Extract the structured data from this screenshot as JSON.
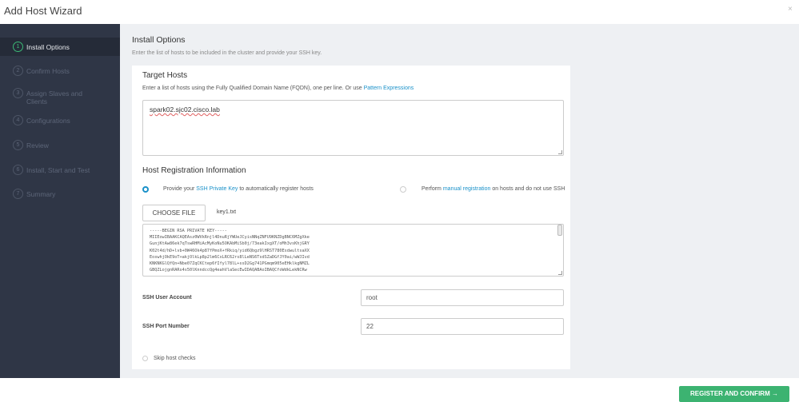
{
  "wizard": {
    "title": "Add Host Wizard",
    "close_glyph": "×"
  },
  "steps": [
    {
      "num": "1",
      "label": "Install Options",
      "active": true
    },
    {
      "num": "2",
      "label": "Confirm Hosts"
    },
    {
      "num": "3",
      "label": "Assign Slaves and Clients"
    },
    {
      "num": "4",
      "label": "Configurations"
    },
    {
      "num": "5",
      "label": "Review"
    },
    {
      "num": "6",
      "label": "Install, Start and Test"
    },
    {
      "num": "7",
      "label": "Summary"
    }
  ],
  "install_options": {
    "title": "Install Options",
    "description": "Enter the list of hosts to be included in the cluster and provide your SSH key."
  },
  "target_hosts": {
    "title": "Target Hosts",
    "help_prefix": "Enter a list of hosts using the Fully Qualified Domain Name (FQDN), one per line. Or use ",
    "help_link": "Pattern Expressions",
    "value": "spark02.sjc02.cisco.lab"
  },
  "registration": {
    "title": "Host Registration Information",
    "option1_prefix": "Provide your ",
    "option1_link": "SSH Private Key",
    "option1_suffix": " to automatically register hosts",
    "option2_prefix": "Perform ",
    "option2_link": "manual registration",
    "option2_suffix": " on hosts and do not use SSH",
    "choose_file_label": "CHOOSE FILE",
    "file_name": "key1.txt",
    "key_lines": [
      "-----BEGIN RSA PRIVATE KEY-----",
      "MIIEowIBAAKCAQEAsz0WVkRnjl4DnuRjYWUeJCyisNNqZNFU9KNZDgBNC6MZgXke",
      "GunjKtAw86ek7qTswRHMiAcMyKoNu5OKAbMiSb0j/73eakIxgXT/oMh3vsKhjGRY",
      "K02t4d/hD+lvb+0W46Ok4p87fPmoX+fRkiq/yid6Qbgz9lHRST780EsdwultsaXX",
      "EoswhjOkE9oT+akjOlkLp8p2lm6CxLRC62rs8lLeNS6TsdSZaDGfJY0ai/wWJIvd",
      "KNKNKGlQfQn+Nbe07ZqCKCtep6fIfyl78lL+ssD2Gg741PGmqm905eEHklkgNMZL",
      "GBQZLojgnRARs4s50lKnndccQg4eahVlaSecEwIDAQABAoIBAQCfoWdkLekNCRw"
    ],
    "ssh_user_label": "SSH User Account",
    "ssh_user_value": "root",
    "ssh_port_label": "SSH Port Number",
    "ssh_port_value": "22",
    "skip_checks_label": "Skip host checks"
  },
  "footer": {
    "register_label": "REGISTER AND CONFIRM →"
  },
  "colors": {
    "sidebar": "#2f3646",
    "accent": "#1a91c9",
    "success": "#3cb371"
  }
}
